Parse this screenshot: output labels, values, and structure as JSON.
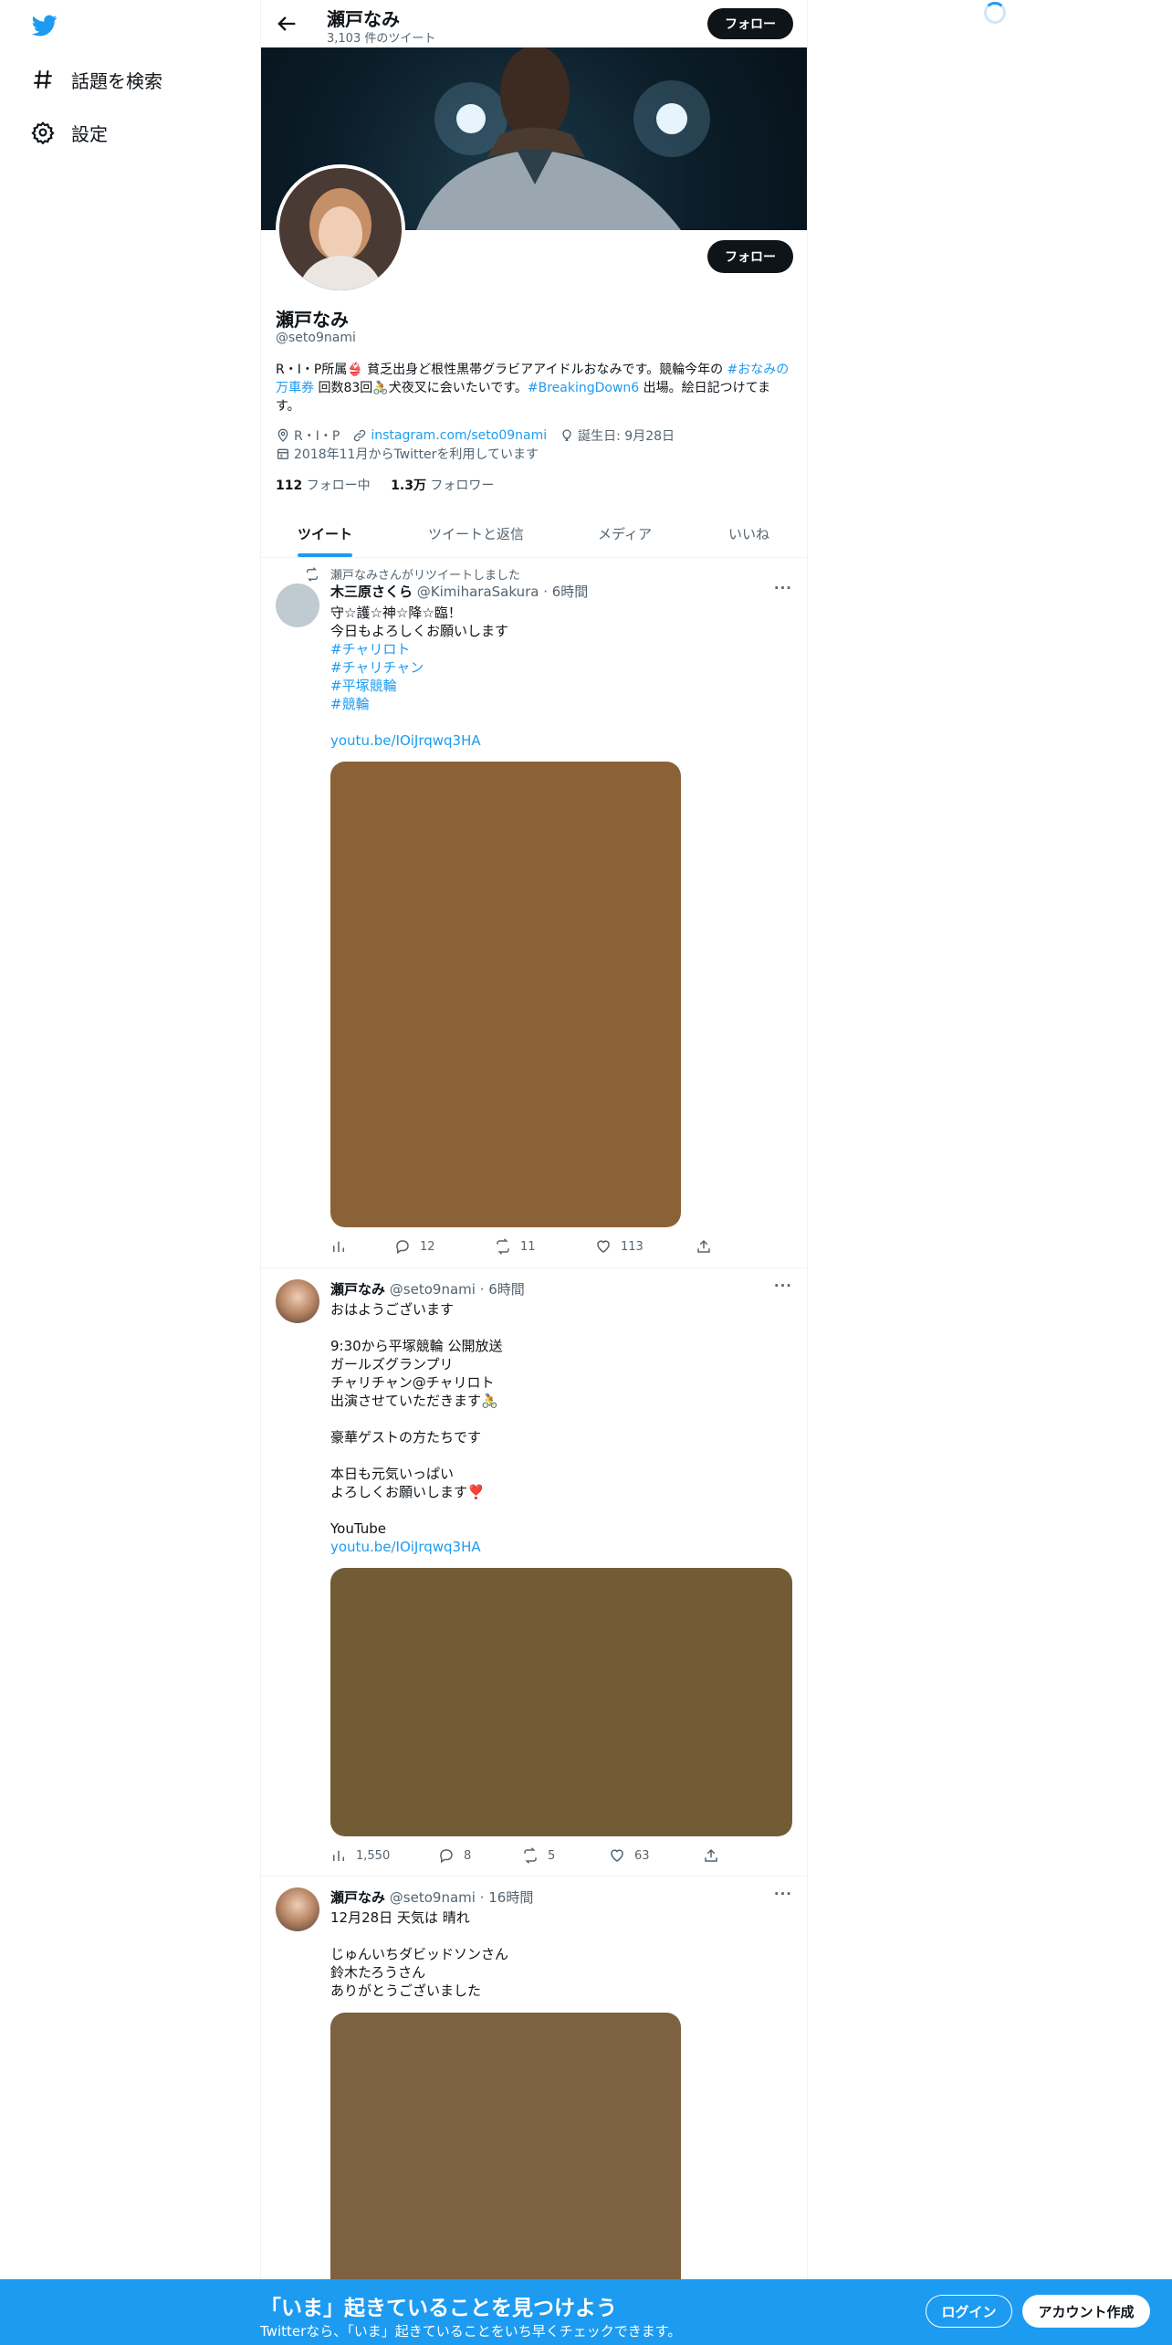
{
  "nav": {
    "explore": "話題を検索",
    "settings": "設定"
  },
  "header": {
    "name": "瀬戸なみ",
    "tweet_count": "3,103 件のツイート",
    "follow_label": "フォロー"
  },
  "profile": {
    "name": "瀬戸なみ",
    "handle": "@seto9nami",
    "follow_label": "フォロー",
    "bio": {
      "p1": "R・I・P所属👙 貧乏出身ど根性黒帯グラビアアイドルおなみです。競輪今年の ",
      "tag1": "#おなみの万車券",
      "p2": " 回数83回🚴犬夜叉に会いたいです。",
      "tag2": "#BreakingDown6",
      "p3": " 出場。絵日記つけてます。"
    },
    "location": "R・I・P",
    "link": "instagram.com/seto09nami",
    "birthday": "誕生日: 9月28日",
    "joined": "2018年11月からTwitterを利用しています",
    "following_count": "112",
    "following_label": "フォロー中",
    "followers_count": "1.3万",
    "followers_label": "フォロワー"
  },
  "tabs": [
    "ツイート",
    "ツイートと返信",
    "メディア",
    "いいね"
  ],
  "tweets": [
    {
      "retweet_label": "瀬戸なみさんがリツイートしました",
      "name": "木三原さくら",
      "handle": "@KimiharaSakura",
      "time": "6時間",
      "lines": [
        "守☆護☆神☆降☆臨！",
        "今日もよろしくお願いします"
      ],
      "tags": [
        "#チャリロト",
        "#チャリチャン",
        "#平塚競輪",
        "#競輪"
      ],
      "link": "youtu.be/IOiJrqwq3HA",
      "media_color": "#8b6237",
      "views": "",
      "replies": "12",
      "retweets": "11",
      "likes": "113"
    },
    {
      "name": "瀬戸なみ",
      "handle": "@seto9nami",
      "time": "6時間",
      "lines": [
        "おはようございます",
        "",
        "9:30から平塚競輪 公開放送",
        "ガールズグランプリ",
        "チャリチャン@チャリロト",
        "出演させていただきます🚴",
        "",
        "豪華ゲストの方たちです",
        "",
        "本日も元気いっぱい",
        "よろしくお願いします❣️",
        "",
        "YouTube"
      ],
      "link": "youtu.be/IOiJrqwq3HA",
      "media_color": "#725c35",
      "views": "1,550",
      "replies": "8",
      "retweets": "5",
      "likes": "63"
    },
    {
      "name": "瀬戸なみ",
      "handle": "@seto9nami",
      "time": "16時間",
      "lines": [
        "12月28日 天気は 晴れ",
        "",
        "じゅんいちダビッドソンさん",
        "鈴木たろうさん",
        "ありがとうございました"
      ],
      "media_color": "#7e6141"
    }
  ],
  "bottom_bar": {
    "title": "「いま」起きていることを見つけよう",
    "subtitle": "Twitterなら、「いま」起きていることをいち早くチェックできます。",
    "login": "ログイン",
    "signup": "アカウント作成"
  },
  "colors": {
    "accent": "#1d9bf0",
    "text": "#0f1419",
    "muted": "#536471"
  }
}
